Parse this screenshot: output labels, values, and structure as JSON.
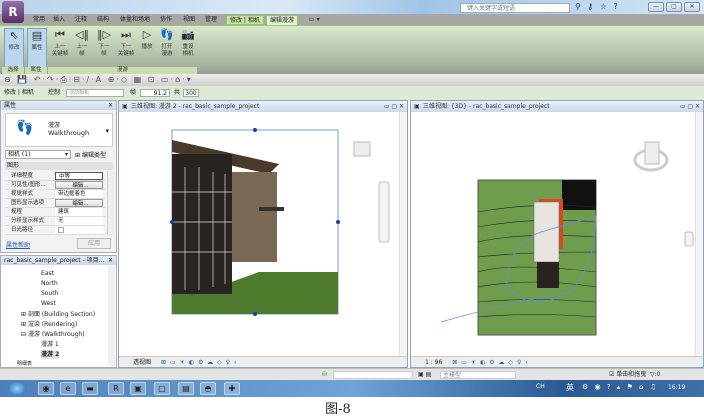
{
  "app": {
    "logo": "R",
    "search_placeholder": "键入关键字或短语",
    "help": "?",
    "window_buttons": [
      "—",
      "▢",
      "✕"
    ]
  },
  "ribbon": {
    "tabs": [
      "常用",
      "插入",
      "注释",
      "结构",
      "体量和场地",
      "协作",
      "视图",
      "管理",
      "修改 | 相机",
      "编辑漫游",
      "▭ ▾"
    ],
    "buttons": [
      {
        "label": "修改",
        "icon": "cursor-icon"
      },
      {
        "label": "属性",
        "icon": "properties-icon"
      },
      {
        "label": "上一\n关键帧",
        "icon": "prev-keyframe-icon"
      },
      {
        "label": "上一\n帧",
        "icon": "prev-frame-icon"
      },
      {
        "label": "下一\n帧",
        "icon": "next-frame-icon"
      },
      {
        "label": "下一\n关键帧",
        "icon": "next-keyframe-icon"
      },
      {
        "label": "播放",
        "icon": "play-icon"
      },
      {
        "label": "打开\n漫游",
        "icon": "footprints-icon"
      },
      {
        "label": "重设\n相机",
        "icon": "camera-icon"
      }
    ],
    "panels": [
      "选择",
      "属性",
      "漫游"
    ]
  },
  "options": {
    "context": "修改 | 相机",
    "control_label": "控制",
    "control_value": "活动相机",
    "frame_label": "帧",
    "frame_value": "91.2",
    "total_label": "共",
    "total_value": "300"
  },
  "properties": {
    "title": "属性",
    "type_cn": "漫游",
    "type_en": "Walkthrough",
    "selector": "相机 (1)",
    "edit_type": "编辑类型",
    "group": "图形",
    "rows": [
      {
        "k": "详细程度",
        "v": "中等",
        "btn": false
      },
      {
        "k": "可见性/图形...",
        "v": "编辑...",
        "btn": true
      },
      {
        "k": "视觉样式",
        "v": "带边框着色",
        "btn": false
      },
      {
        "k": "图形显示选项",
        "v": "编辑...",
        "btn": true
      },
      {
        "k": "规程",
        "v": "建筑",
        "btn": false
      },
      {
        "k": "分析显示样式",
        "v": "无",
        "btn": false
      },
      {
        "k": "日光路径",
        "v": "",
        "btn": false
      }
    ],
    "help": "属性帮助",
    "apply": "应用"
  },
  "browser": {
    "title": "rac_basic_sample_project - 项目...",
    "items": [
      "East",
      "North",
      "South",
      "West",
      "剖面 (Building Section)",
      "渲染 (Rendering)",
      "漫游 (Walkthrough)",
      "漫游 1",
      "漫游 2",
      "明细表"
    ]
  },
  "views": {
    "left": {
      "title": "三维视图: 漫游 2 - rac_basic_sample_project",
      "footer": "透视图"
    },
    "right": {
      "title": "三维视图: {3D} - rac_basic_sample_project",
      "footer": "1 : 96"
    }
  },
  "status": {
    "model": "主模型",
    "drag": "单击和拖曳",
    "filter": ":0"
  },
  "taskbar": {
    "lang": "CH",
    "ime": "英",
    "time": "16:19"
  },
  "caption": "图-8"
}
